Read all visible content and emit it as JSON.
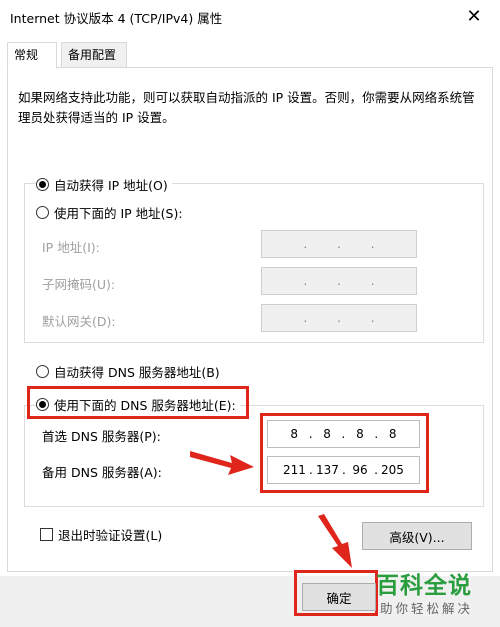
{
  "window": {
    "title": "Internet 协议版本 4 (TCP/IPv4) 属性",
    "close_glyph": "✕"
  },
  "tabs": [
    {
      "label": "常规",
      "active": true
    },
    {
      "label": "备用配置",
      "active": false
    }
  ],
  "description": "如果网络支持此功能，则可以获取自动指派的 IP 设置。否则，你需要从网络系统管理员处获得适当的 IP 设置。",
  "ip_section": {
    "auto_option": "自动获得 IP 地址(O)",
    "auto_selected": true,
    "manual_option": "使用下面的 IP 地址(S):",
    "manual_selected": false,
    "fields": [
      {
        "label": "IP 地址(I):",
        "octets": [
          "",
          "",
          "",
          ""
        ]
      },
      {
        "label": "子网掩码(U):",
        "octets": [
          "",
          "",
          "",
          ""
        ]
      },
      {
        "label": "默认网关(D):",
        "octets": [
          "",
          "",
          "",
          ""
        ]
      }
    ]
  },
  "dns_section": {
    "auto_option": "自动获得 DNS 服务器地址(B)",
    "auto_selected": false,
    "manual_option": "使用下面的 DNS 服务器地址(E):",
    "manual_selected": true,
    "preferred": {
      "label": "首选 DNS 服务器(P):",
      "octets": [
        "8",
        "8",
        "8",
        "8"
      ]
    },
    "alternate": {
      "label": "备用 DNS 服务器(A):",
      "octets": [
        "211",
        "137",
        "96",
        "205"
      ]
    }
  },
  "validate_on_exit": {
    "label": "退出时验证设置(L)",
    "checked": false
  },
  "buttons": {
    "advanced": "高级(V)...",
    "ok": "确定"
  },
  "watermark": {
    "title": "百科全说",
    "subtitle": "助你轻松解决"
  },
  "colors": {
    "highlight_red": "#e0261b",
    "watermark_green": "#2a9d3f"
  }
}
